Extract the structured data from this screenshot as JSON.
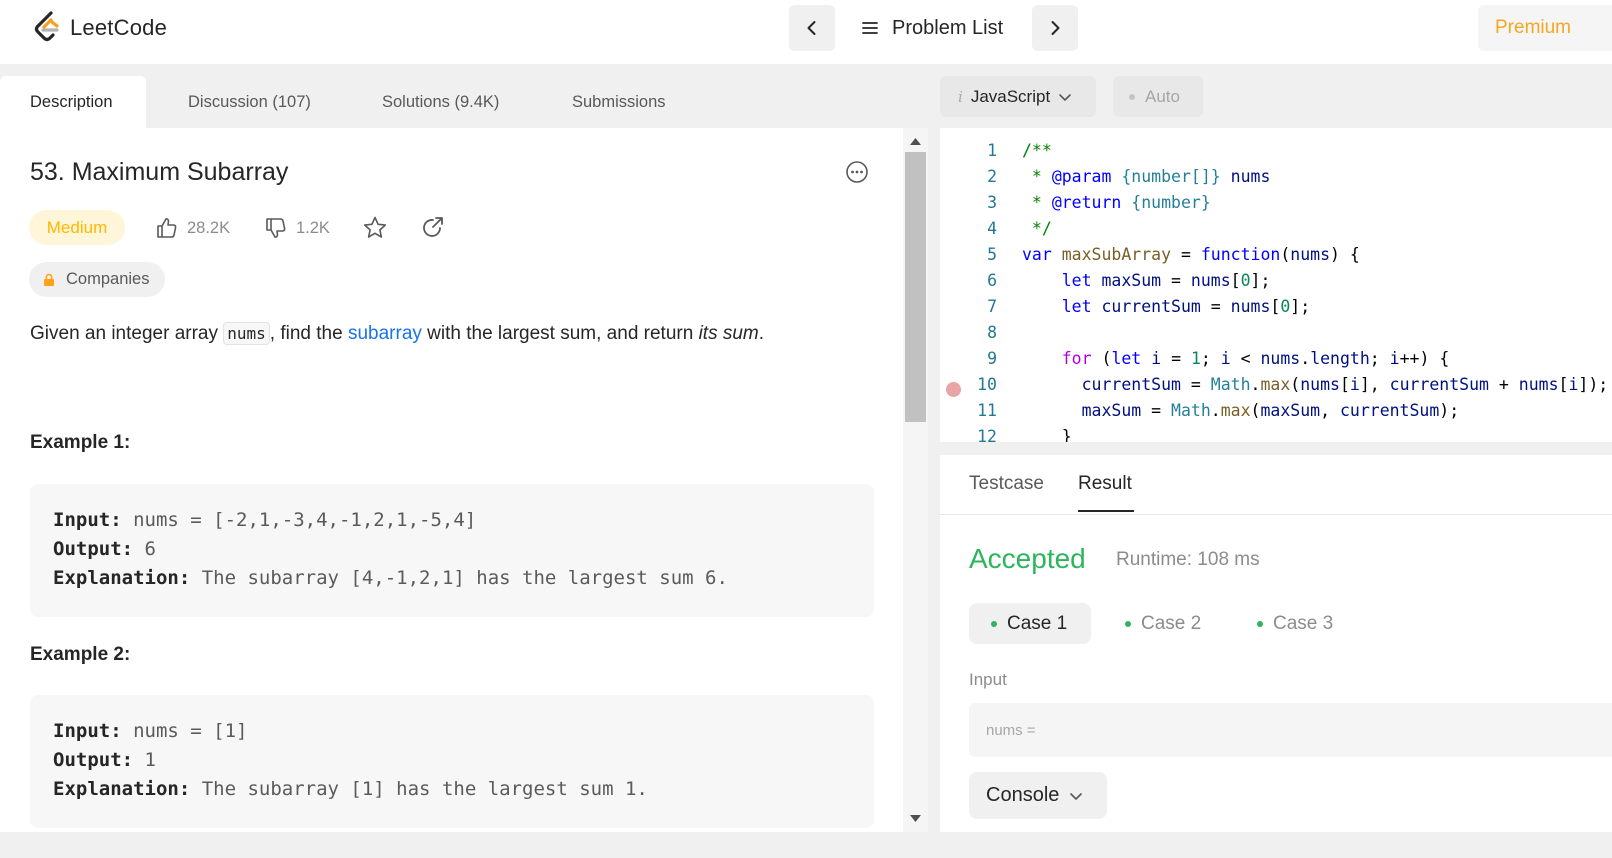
{
  "header": {
    "logo_text": "LeetCode",
    "problem_list_label": "Problem List",
    "premium_label": "Premium"
  },
  "tabs": [
    {
      "label": "Description",
      "active": true
    },
    {
      "label": "Discussion (107)",
      "active": false
    },
    {
      "label": "Solutions (9.4K)",
      "active": false
    },
    {
      "label": "Submissions",
      "active": false
    }
  ],
  "problem": {
    "title": "53. Maximum Subarray",
    "difficulty": "Medium",
    "likes": "28.2K",
    "dislikes": "1.2K",
    "companies_label": "Companies",
    "statement": {
      "part1": "Given an integer array ",
      "code": "nums",
      "part2": ", find the ",
      "link": "subarray",
      "part3": " with the largest sum, and return ",
      "em": "its sum",
      "part4": "."
    },
    "examples": [
      {
        "title": "Example 1:",
        "input_label": "Input:",
        "input": " nums = [-2,1,-3,4,-1,2,1,-5,4]",
        "output_label": "Output:",
        "output": " 6",
        "explanation_label": "Explanation:",
        "explanation": " The subarray [4,-1,2,1] has the largest sum 6."
      },
      {
        "title": "Example 2:",
        "input_label": "Input:",
        "input": " nums = [1]",
        "output_label": "Output:",
        "output": " 1",
        "explanation_label": "Explanation:",
        "explanation": " The subarray [1] has the largest sum 1."
      }
    ]
  },
  "editor": {
    "language": "JavaScript",
    "language_icon": "i",
    "auto_label": "Auto",
    "line_numbers": [
      "1",
      "2",
      "3",
      "4",
      "5",
      "6",
      "7",
      "8",
      "9",
      "10",
      "11",
      "12"
    ]
  },
  "result": {
    "tabs": [
      "Testcase",
      "Result"
    ],
    "status": "Accepted",
    "runtime": "Runtime: 108 ms",
    "cases": [
      "Case 1",
      "Case 2",
      "Case 3"
    ],
    "input_label": "Input",
    "input_value": "nums =",
    "console_label": "Console"
  },
  "colors": {
    "accepted": "#2db55d",
    "medium": "#ffb800",
    "premium": "#f5a623",
    "link": "#1a73e8"
  }
}
